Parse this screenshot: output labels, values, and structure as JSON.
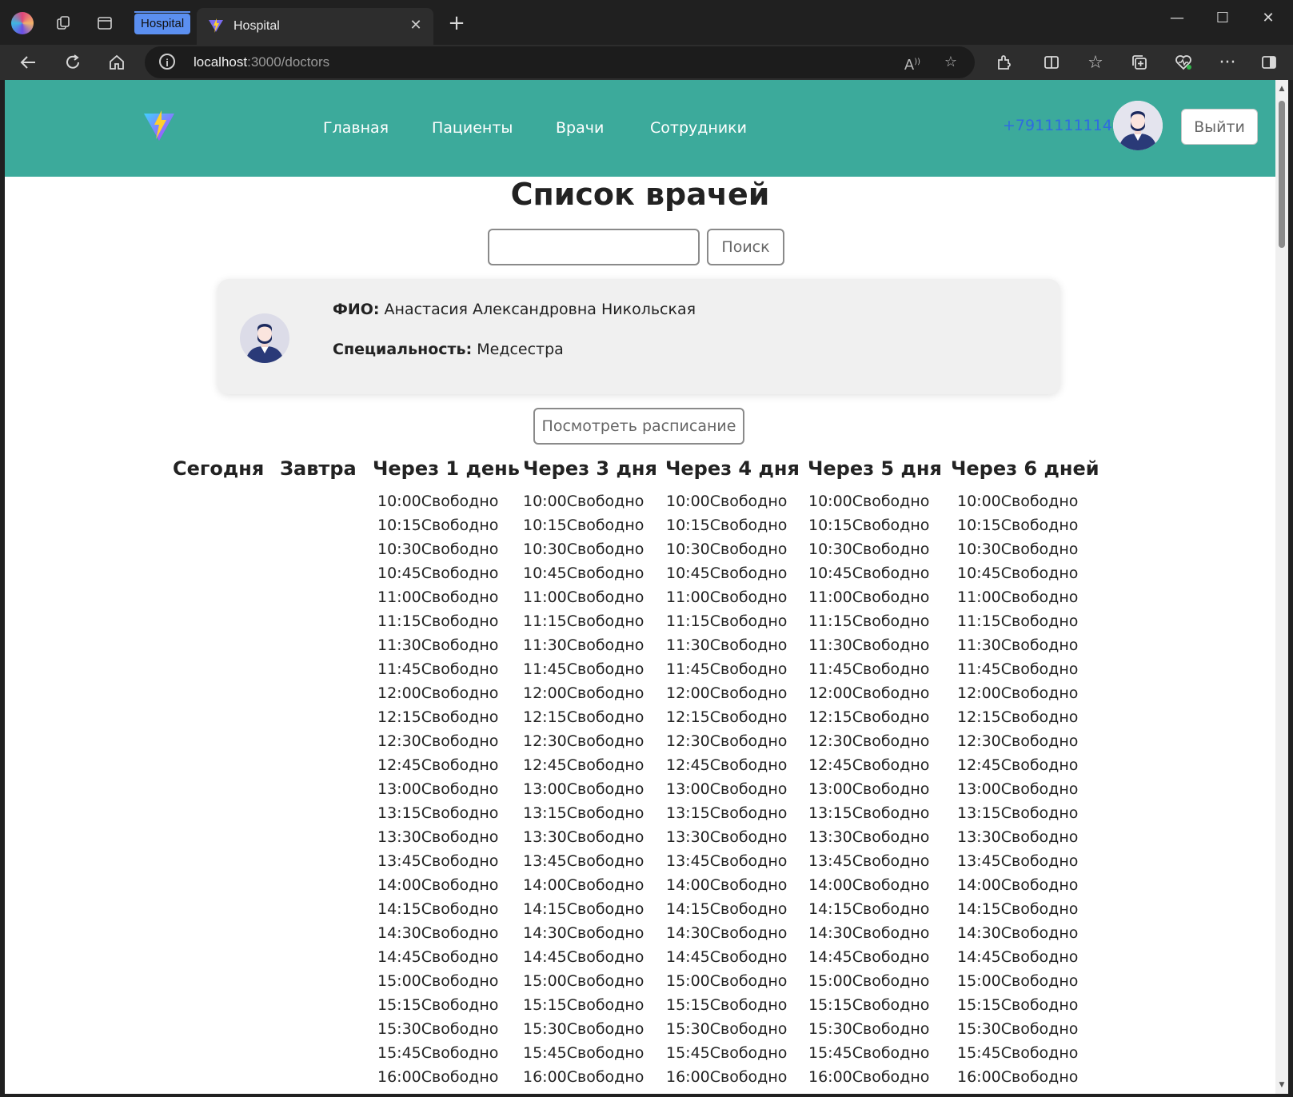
{
  "browser": {
    "tab_group_label": "Hospital",
    "tab_title": "Hospital",
    "address": {
      "host": "localhost",
      "path": ":3000/doctors"
    }
  },
  "header": {
    "nav": [
      "Главная",
      "Пациенты",
      "Врачи",
      "Сотрудники"
    ],
    "phone": "+7911111114",
    "logout_label": "Выйти"
  },
  "page": {
    "title": "Список врачей",
    "search": {
      "value": "",
      "placeholder": "",
      "button_label": "Поиск"
    }
  },
  "doctor_card": {
    "name_label": "ФИО:",
    "name": "Анастасия Александровна Никольская",
    "specialty_label": "Специальность:",
    "specialty": "Медсестра"
  },
  "schedule": {
    "button_label": "Посмотреть расписание",
    "days": [
      "Сегодня",
      "Завтра",
      "Через 1 день",
      "Через 3 дня",
      "Через 4 дня",
      "Через 5 дня",
      "Через 6 дней"
    ],
    "slot_days_count_note": "",
    "slots": [
      "10:00Свободно",
      "10:15Свободно",
      "10:30Свободно",
      "10:45Свободно",
      "11:00Свободно",
      "11:15Свободно",
      "11:30Свободно",
      "11:45Свободно",
      "12:00Свободно",
      "12:15Свободно",
      "12:30Свободно",
      "12:45Свободно",
      "13:00Свободно",
      "13:15Свободно",
      "13:30Свободно",
      "13:45Свободно",
      "14:00Свободно",
      "14:15Свободно",
      "14:30Свободно",
      "14:45Свободно",
      "15:00Свободно",
      "15:15Свободно",
      "15:30Свободно",
      "15:45Свободно",
      "16:00Свободно"
    ]
  },
  "colors": {
    "header_bg": "#3caa9b",
    "phone_link": "#2f6be0",
    "card_bg": "#f0f0f0"
  },
  "icons": {
    "toolbar": [
      "back-icon",
      "refresh-icon",
      "home-icon",
      "info-icon",
      "read-aloud-icon",
      "favorite-star-icon",
      "extensions-icon",
      "split-screen-icon",
      "favorites-icon",
      "collections-icon",
      "browser-essentials-icon",
      "more-icon",
      "sidebar-icon"
    ]
  }
}
